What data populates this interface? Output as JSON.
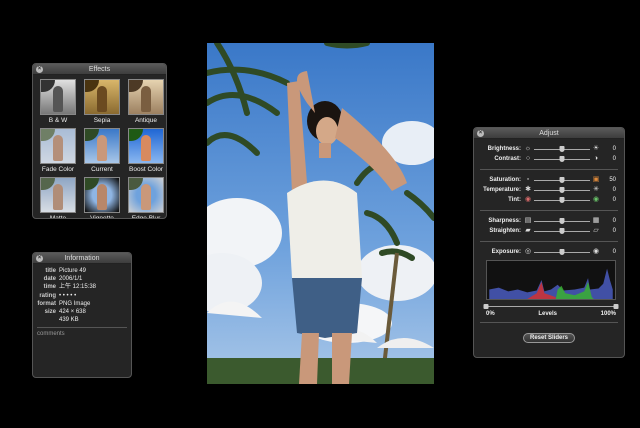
{
  "effects_panel": {
    "title": "Effects",
    "items": [
      {
        "label": "B & W"
      },
      {
        "label": "Sepia"
      },
      {
        "label": "Antique"
      },
      {
        "label": "Fade Color"
      },
      {
        "label": "Current"
      },
      {
        "label": "Boost Color"
      },
      {
        "label": "Matte"
      },
      {
        "label": "Vignette"
      },
      {
        "label": "Edge Blur"
      }
    ]
  },
  "info_panel": {
    "title": "Information",
    "rows": [
      {
        "key": "title",
        "value": "Picture 49"
      },
      {
        "key": "date",
        "value": "2006/1/1"
      },
      {
        "key": "time",
        "value": "上午 12:15:38"
      },
      {
        "key": "rating",
        "value": "• • • • •"
      },
      {
        "key": "format",
        "value": "PNG Image"
      },
      {
        "key": "size",
        "value": "424 × 638"
      },
      {
        "key": "",
        "value": "439 KB"
      }
    ],
    "comments_label": "comments"
  },
  "adjust_panel": {
    "title": "Adjust",
    "group1": [
      {
        "label": "Brightness:",
        "value": "0",
        "level": 0.5,
        "icon_left": "sun-small-icon",
        "icon_right": "sun-large-icon"
      },
      {
        "label": "Contrast:",
        "value": "0",
        "level": 0.5,
        "icon_left": "contrast-low-icon",
        "icon_right": "contrast-high-icon"
      }
    ],
    "group2": [
      {
        "label": "Saturation:",
        "value": "50",
        "level": 0.5,
        "icon_left": "saturation-low-icon",
        "icon_right": "saturation-high-icon"
      },
      {
        "label": "Temperature:",
        "value": "0",
        "level": 0.5,
        "icon_left": "cool-icon",
        "icon_right": "warm-icon"
      },
      {
        "label": "Tint:",
        "value": "0",
        "level": 0.5,
        "icon_left": "tint-red-icon",
        "icon_right": "tint-green-icon"
      }
    ],
    "group3": [
      {
        "label": "Sharpness:",
        "value": "0",
        "level": 0.5,
        "icon_left": "blur-icon",
        "icon_right": "sharp-icon"
      },
      {
        "label": "Straighten:",
        "value": "0",
        "level": 0.5,
        "icon_left": "tilt-left-icon",
        "icon_right": "tilt-right-icon"
      }
    ],
    "exposure": {
      "label": "Exposure:",
      "value": "0",
      "level": 0.5
    },
    "levels": {
      "left": "0%",
      "center": "Levels",
      "right": "100%",
      "black_point": 0.0,
      "white_point": 1.0
    },
    "reset_label": "Reset Sliders"
  }
}
